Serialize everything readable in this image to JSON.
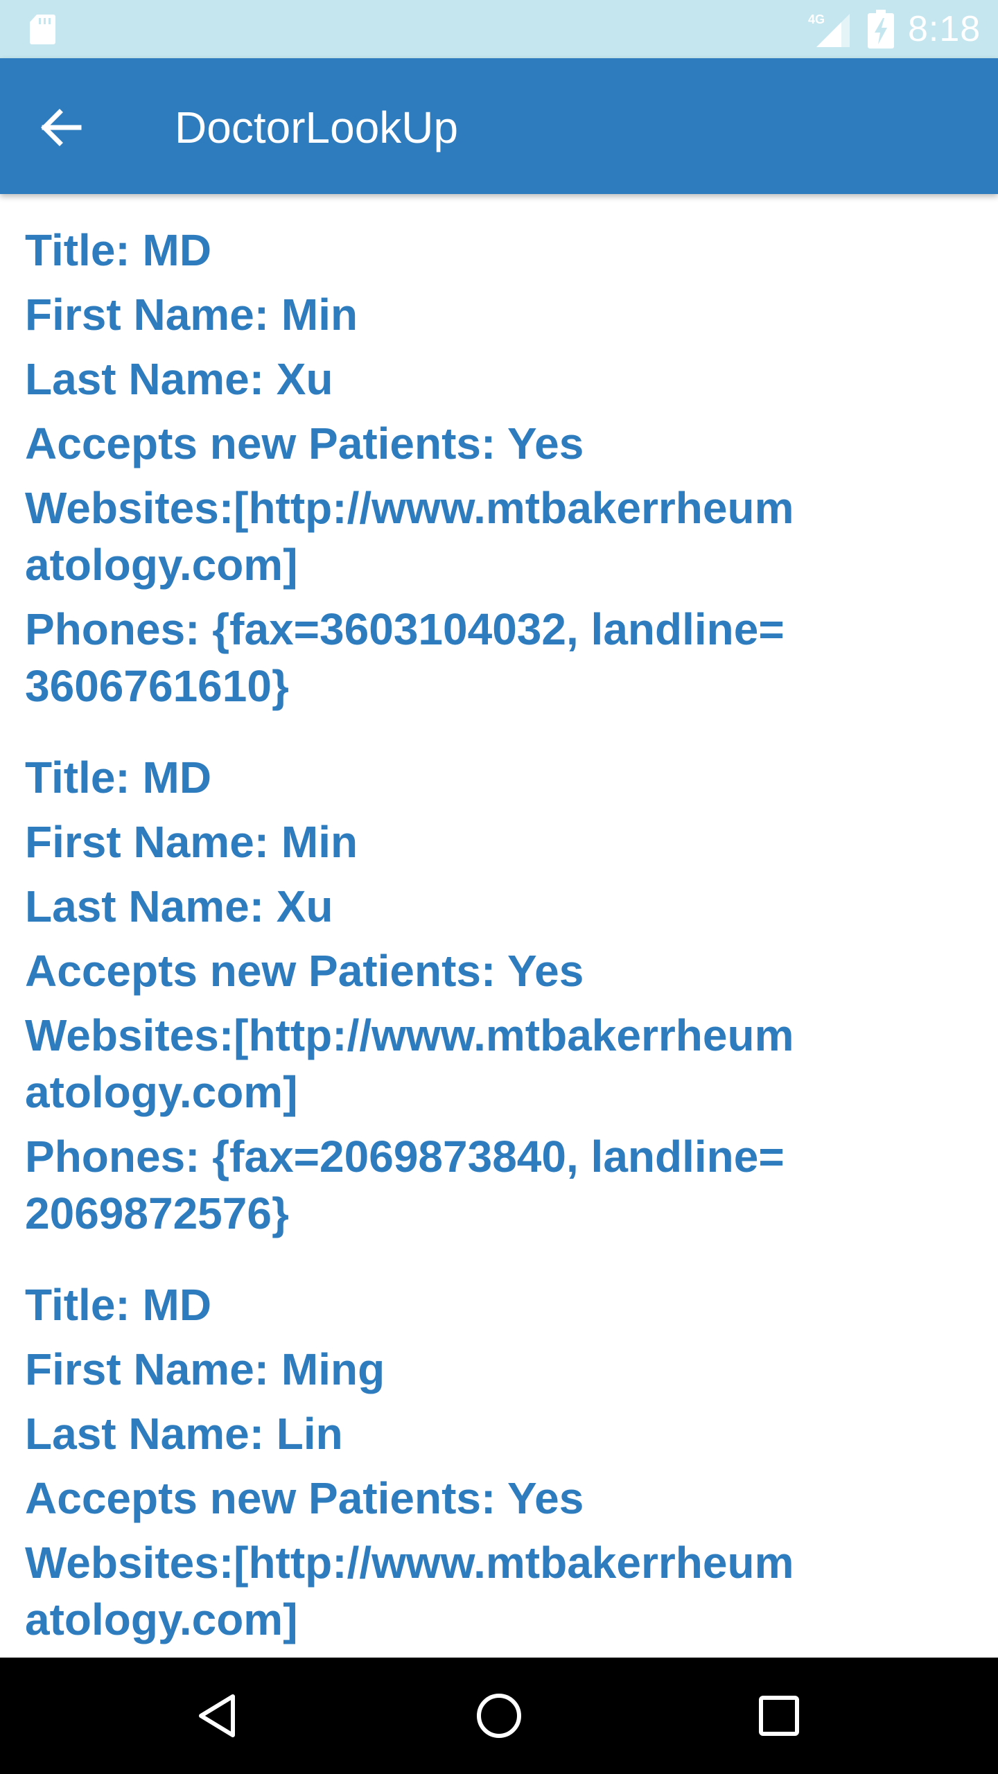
{
  "status_bar": {
    "time": "8:18",
    "network_label": "4G",
    "icons": [
      "sd-card-icon",
      "signal-icon",
      "battery-charging-icon"
    ],
    "background_color": "#c5e6ee"
  },
  "app_bar": {
    "title": "DoctorLookUp",
    "back_icon": "arrow-back-icon",
    "background_color": "#2e7cbd"
  },
  "doctors": [
    {
      "title": "Title: MD",
      "first_name": "First Name: Min",
      "last_name": "Last Name: Xu",
      "accepts": "Accepts new Patients: Yes",
      "websites": "Websites:[http://www.mtbakerrheumatology.com]",
      "phones": "Phones: {fax=3603104032, landline=3606761610}"
    },
    {
      "title": "Title: MD",
      "first_name": "First Name: Min",
      "last_name": "Last Name: Xu",
      "accepts": "Accepts new Patients: Yes",
      "websites": "Websites:[http://www.mtbakerrheumatology.com]",
      "phones": "Phones: {fax=2069873840, landline=2069872576}"
    },
    {
      "title": "Title: MD",
      "first_name": "First Name: Ming",
      "last_name": "Last Name: Lin",
      "accepts": "Accepts new Patients: Yes",
      "websites": "Websites:[http://www.mtbakerrheumatology.com]"
    }
  ],
  "nav_bar": {
    "icons": [
      "nav-back-icon",
      "nav-home-icon",
      "nav-recents-icon"
    ]
  },
  "colors": {
    "text": "#2e7cbd",
    "nav_background": "#000000"
  }
}
